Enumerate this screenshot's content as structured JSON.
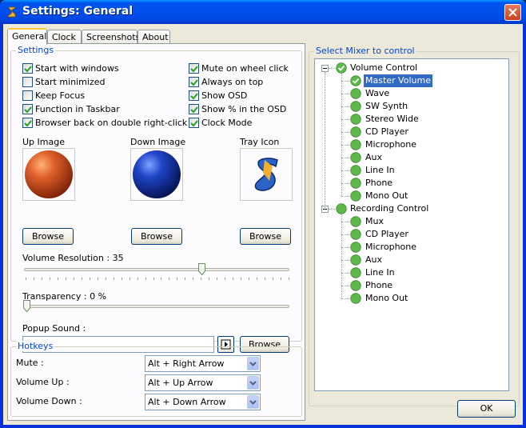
{
  "window": {
    "title": "Settings: General"
  },
  "tabs": [
    "General",
    "Clock",
    "Screenshots",
    "About"
  ],
  "settings": {
    "group_title": "Settings",
    "checkboxes_left": [
      {
        "label": "Start with windows",
        "checked": true
      },
      {
        "label": "Start minimized",
        "checked": false
      },
      {
        "label": "Keep Focus",
        "checked": false
      },
      {
        "label": "Function in Taskbar",
        "checked": true
      },
      {
        "label": "Browser back on double right-click",
        "checked": true
      }
    ],
    "checkboxes_right": [
      {
        "label": "Mute on wheel click",
        "checked": true
      },
      {
        "label": "Always on top",
        "checked": true
      },
      {
        "label": "Show OSD",
        "checked": true
      },
      {
        "label": "Show % in the OSD",
        "checked": true
      },
      {
        "label": "Clock Mode",
        "checked": true
      }
    ],
    "images": {
      "up_label": "Up Image",
      "down_label": "Down Image",
      "tray_label": "Tray Icon",
      "browse_label": "Browse"
    },
    "volume_resolution": {
      "label": "Volume Resolution : 35",
      "value": 35,
      "fraction": 0.67
    },
    "transparency": {
      "label": "Transparency : 0 %",
      "value": 0,
      "fraction": 0.0
    },
    "popup_sound": {
      "label": "Popup Sound :",
      "value": "",
      "browse_label": "Browse"
    }
  },
  "hotkeys": {
    "group_title": "Hotkeys",
    "rows": [
      {
        "label": "Mute :",
        "value": "Alt + Right Arrow"
      },
      {
        "label": "Volume Up :",
        "value": "Alt + Up Arrow"
      },
      {
        "label": "Volume Down :",
        "value": "Alt + Down Arrow"
      }
    ]
  },
  "mixer": {
    "group_title": "Select Mixer to control",
    "volume_control": {
      "label": "Volume Control",
      "items": [
        "Master Volume",
        "Wave",
        "SW Synth",
        "Stereo Wide",
        "CD Player",
        "Microphone",
        "Aux",
        "Line In",
        "Phone",
        "Mono Out"
      ],
      "selected": "Master Volume"
    },
    "recording_control": {
      "label": "Recording Control",
      "items": [
        "Mux",
        "CD Player",
        "Microphone",
        "Aux",
        "Line In",
        "Phone",
        "Mono Out"
      ]
    }
  },
  "footer": {
    "ok_label": "OK"
  },
  "colors": {
    "title_blue": "#0050ee",
    "group_title": "#0046d5",
    "selection": "#316ac5",
    "node_green": "#5cb84a",
    "up_ball": "#d4501e",
    "down_ball": "#1b3fb0"
  }
}
